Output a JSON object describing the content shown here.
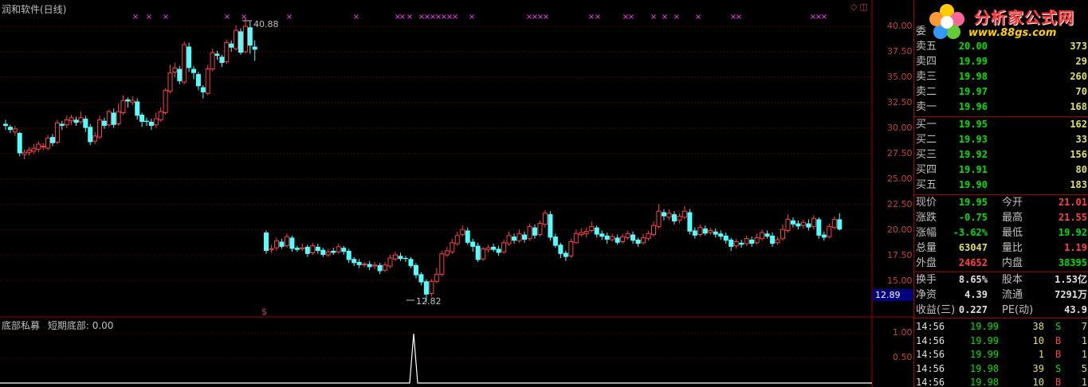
{
  "window": {
    "title": "润和软件(日线)"
  },
  "indicator": {
    "name": "底部私募",
    "line_label": "短期底部: 0.00"
  },
  "price_axis": [
    "40.00",
    "37.50",
    "35.00",
    "32.50",
    "30.00",
    "27.50",
    "25.00",
    "22.50",
    "20.00",
    "17.50",
    "15.00"
  ],
  "indicator_axis": [
    "1.00",
    "0.50"
  ],
  "annotations": {
    "high": "40.88",
    "low": "12.82",
    "current_price_marker": "12.89",
    "signal_mark": "$"
  },
  "logo": {
    "text": "分析家公式网",
    "url": "www.88gs.com"
  },
  "colors": {
    "up": "#ff4040",
    "down": "#54ffff",
    "grid": "#800000",
    "axis_text": "#c84040",
    "signal": "#ff40ff"
  },
  "quote": {
    "header_label": "委",
    "asks": [
      {
        "label": "卖五",
        "price": "20.00",
        "vol": "373"
      },
      {
        "label": "卖四",
        "price": "19.99",
        "vol": "29"
      },
      {
        "label": "卖三",
        "price": "19.98",
        "vol": "260"
      },
      {
        "label": "卖二",
        "price": "19.97",
        "vol": "70"
      },
      {
        "label": "卖一",
        "price": "19.96",
        "vol": "168"
      }
    ],
    "bids": [
      {
        "label": "买一",
        "price": "19.95",
        "vol": "162"
      },
      {
        "label": "买二",
        "price": "19.93",
        "vol": "33"
      },
      {
        "label": "买三",
        "price": "19.92",
        "vol": "156"
      },
      {
        "label": "买四",
        "price": "19.91",
        "vol": "80"
      },
      {
        "label": "买五",
        "price": "19.90",
        "vol": "183"
      }
    ],
    "stats": [
      {
        "l1": "现价",
        "v1": "19.95",
        "l2": "今开",
        "v2": "21.01",
        "c1": "green",
        "c2": "red"
      },
      {
        "l1": "涨跌",
        "v1": "-0.75",
        "l2": "最高",
        "v2": "21.55",
        "c1": "green",
        "c2": "red"
      },
      {
        "l1": "涨幅",
        "v1": "-3.62%",
        "l2": "最低",
        "v2": "19.92",
        "c1": "green",
        "c2": "green"
      },
      {
        "l1": "总量",
        "v1": "63047",
        "l2": "量比",
        "v2": "1.19",
        "c1": "yellow",
        "c2": "red"
      },
      {
        "l1": "外盘",
        "v1": "24652",
        "l2": "内盘",
        "v2": "38395",
        "c1": "red",
        "c2": "green"
      }
    ],
    "stats2": [
      {
        "l1": "换手",
        "v1": "8.65%",
        "l2": "股本",
        "v2": "1.53亿"
      },
      {
        "l1": "净资",
        "v1": "4.39",
        "l2": "流通",
        "v2": "7291万"
      },
      {
        "l1": "收益(三)",
        "v1": "0.227",
        "l2": "PE(动)",
        "v2": "43.9"
      }
    ],
    "ticks": [
      {
        "time": "14:56",
        "price": "19.99",
        "vol": "38",
        "side": "S",
        "n": "7"
      },
      {
        "time": "14:56",
        "price": "19.99",
        "vol": "10",
        "side": "B",
        "n": "1"
      },
      {
        "time": "14:56",
        "price": "19.99",
        "vol": "1",
        "side": "B",
        "n": "1"
      },
      {
        "time": "14:56",
        "price": "19.98",
        "vol": "39",
        "side": "S",
        "n": "5"
      },
      {
        "time": "14:56",
        "price": "19.98",
        "vol": "10",
        "side": "B",
        "n": "1"
      }
    ]
  },
  "chart_data": {
    "type": "candlestick",
    "ylim": [
      12,
      42
    ],
    "candles": [
      [
        30.4,
        30.2,
        30.8,
        29.8
      ],
      [
        30.1,
        29.8,
        30.3,
        29.5
      ],
      [
        29.6,
        29.9,
        30.2,
        29.2
      ],
      [
        29.5,
        27.5,
        29.6,
        27.2
      ],
      [
        27.4,
        27.6,
        27.9,
        26.9
      ],
      [
        27.6,
        27.8,
        28.1,
        27.3
      ],
      [
        27.7,
        28.0,
        28.4,
        27.4
      ],
      [
        27.9,
        28.4,
        28.7,
        27.6
      ],
      [
        28.2,
        28.2,
        28.5,
        27.8
      ],
      [
        28.0,
        29.0,
        29.3,
        27.8
      ],
      [
        29.1,
        28.5,
        29.4,
        28.2
      ],
      [
        28.6,
        30.5,
        30.8,
        28.4
      ],
      [
        30.4,
        30.2,
        30.7,
        29.8
      ],
      [
        30.3,
        30.8,
        31.2,
        30.0
      ],
      [
        30.7,
        31.0,
        31.3,
        30.3
      ],
      [
        30.8,
        30.5,
        31.1,
        30.2
      ],
      [
        30.6,
        31.0,
        31.6,
        30.4
      ],
      [
        30.9,
        30.0,
        31.2,
        29.6
      ],
      [
        30.1,
        28.6,
        30.4,
        28.3
      ],
      [
        28.7,
        29.2,
        29.6,
        28.4
      ],
      [
        29.1,
        30.8,
        31.2,
        28.9
      ],
      [
        30.7,
        30.2,
        31.0,
        29.9
      ],
      [
        30.3,
        31.6,
        31.8,
        30.1
      ],
      [
        31.5,
        30.3,
        31.9,
        30.0
      ],
      [
        30.4,
        31.6,
        32.4,
        30.2
      ],
      [
        31.5,
        32.7,
        33.2,
        31.3
      ],
      [
        32.8,
        32.6,
        33.0,
        32.0
      ],
      [
        32.5,
        32.7,
        33.1,
        32.2
      ],
      [
        32.6,
        31.2,
        32.9,
        30.8
      ],
      [
        31.3,
        30.6,
        31.5,
        30.1
      ],
      [
        30.7,
        30.6,
        31.0,
        30.2
      ],
      [
        30.6,
        30.2,
        30.9,
        29.8
      ],
      [
        30.3,
        30.9,
        31.5,
        30.0
      ],
      [
        30.8,
        31.6,
        32.0,
        30.6
      ],
      [
        31.5,
        33.7,
        33.9,
        31.3
      ],
      [
        33.6,
        35.4,
        36.2,
        33.4
      ],
      [
        35.5,
        35.9,
        36.4,
        35.0
      ],
      [
        35.8,
        34.6,
        36.1,
        34.3
      ],
      [
        34.5,
        38.2,
        38.5,
        34.3
      ],
      [
        38.0,
        35.9,
        38.4,
        35.5
      ],
      [
        35.8,
        35.4,
        36.1,
        34.8
      ],
      [
        35.3,
        34.1,
        35.5,
        33.7
      ],
      [
        34.0,
        33.5,
        34.2,
        32.9
      ],
      [
        33.4,
        35.8,
        36.2,
        33.2
      ],
      [
        35.8,
        37.4,
        37.8,
        35.6
      ],
      [
        37.3,
        37.1,
        37.6,
        36.7
      ],
      [
        37.0,
        36.4,
        37.2,
        36.0
      ],
      [
        36.5,
        38.4,
        38.7,
        36.3
      ],
      [
        38.3,
        37.9,
        38.6,
        37.5
      ],
      [
        37.8,
        39.6,
        40.1,
        37.6
      ],
      [
        39.5,
        37.4,
        39.8,
        37.2
      ],
      [
        37.5,
        40.0,
        40.9,
        37.3
      ],
      [
        39.9,
        38.1,
        40.5,
        37.3
      ],
      [
        38.0,
        37.7,
        38.6,
        36.6
      ]
    ],
    "candles2": [
      [
        19.7,
        17.9,
        19.9,
        17.6
      ],
      [
        18.0,
        18.1,
        18.5,
        17.7
      ],
      [
        18.2,
        18.9,
        19.2,
        17.9
      ],
      [
        18.8,
        18.3,
        19.1,
        18.1
      ],
      [
        18.4,
        19.3,
        19.6,
        18.2
      ],
      [
        19.2,
        18.1,
        19.4,
        17.8
      ],
      [
        18.2,
        18.0,
        18.4,
        17.8
      ],
      [
        18.1,
        18.2,
        18.6,
        17.9
      ],
      [
        18.3,
        17.6,
        18.5,
        17.3
      ],
      [
        17.7,
        18.4,
        18.7,
        17.5
      ],
      [
        18.3,
        17.9,
        18.6,
        17.6
      ],
      [
        18.0,
        17.5,
        18.2,
        17.3
      ],
      [
        17.5,
        17.8,
        18.1,
        17.3
      ],
      [
        17.9,
        17.7,
        18.2,
        17.5
      ],
      [
        17.8,
        18.3,
        18.6,
        17.6
      ],
      [
        18.2,
        17.8,
        18.4,
        17.5
      ],
      [
        17.9,
        17.0,
        18.1,
        16.7
      ],
      [
        17.1,
        16.7,
        17.3,
        16.4
      ],
      [
        16.8,
        16.5,
        17.1,
        16.2
      ],
      [
        16.6,
        16.6,
        16.8,
        16.3
      ],
      [
        16.6,
        16.3,
        16.9,
        16.0
      ],
      [
        16.4,
        16.5,
        16.8,
        16.1
      ],
      [
        16.5,
        15.9,
        16.7,
        15.6
      ],
      [
        16.0,
        16.5,
        16.8,
        15.8
      ],
      [
        16.4,
        17.2,
        17.5,
        16.2
      ],
      [
        17.1,
        17.5,
        17.8,
        16.9
      ],
      [
        17.4,
        17.1,
        17.7,
        16.9
      ],
      [
        17.2,
        17.1,
        17.4,
        16.8
      ],
      [
        17.1,
        16.4,
        17.3,
        16.2
      ],
      [
        16.5,
        15.5,
        16.7,
        15.2
      ],
      [
        15.6,
        14.8,
        15.8,
        14.5
      ],
      [
        14.9,
        13.6,
        15.1,
        12.8
      ],
      [
        13.7,
        14.9,
        15.1,
        13.4
      ],
      [
        14.9,
        15.6,
        16.2,
        14.7
      ],
      [
        15.6,
        17.6,
        17.9,
        15.4
      ],
      [
        17.5,
        17.9,
        18.3,
        17.3
      ],
      [
        17.8,
        18.7,
        19.1,
        17.6
      ],
      [
        18.6,
        19.4,
        19.8,
        18.4
      ],
      [
        19.5,
        20.0,
        20.4,
        19.3
      ],
      [
        19.9,
        18.7,
        20.2,
        18.5
      ],
      [
        18.8,
        18.3,
        19.1,
        17.8
      ],
      [
        18.4,
        17.0,
        18.7,
        16.8
      ],
      [
        17.1,
        18.1,
        18.3,
        16.9
      ],
      [
        18.0,
        18.2,
        18.5,
        17.7
      ],
      [
        18.3,
        18.0,
        18.6,
        17.8
      ],
      [
        18.1,
        17.7,
        18.4,
        17.4
      ],
      [
        17.8,
        18.7,
        19.0,
        17.6
      ],
      [
        18.6,
        19.4,
        19.8,
        18.4
      ],
      [
        19.3,
        18.9,
        19.6,
        18.6
      ],
      [
        18.9,
        19.6,
        20.0,
        18.7
      ],
      [
        19.5,
        19.0,
        19.8,
        18.7
      ],
      [
        19.1,
        20.3,
        20.6,
        18.9
      ],
      [
        20.2,
        19.4,
        20.5,
        19.1
      ],
      [
        19.5,
        20.6,
        20.9,
        19.3
      ],
      [
        20.5,
        21.6,
        21.9,
        20.2
      ],
      [
        21.5,
        19.2,
        21.8,
        18.9
      ],
      [
        19.3,
        18.4,
        19.6,
        18.2
      ],
      [
        18.5,
        17.6,
        18.7,
        17.2
      ],
      [
        17.7,
        17.3,
        17.9,
        16.9
      ],
      [
        17.4,
        18.8,
        19.1,
        17.2
      ],
      [
        18.7,
        19.6,
        20.0,
        18.6
      ],
      [
        19.5,
        19.7,
        20.1,
        19.3
      ],
      [
        19.6,
        19.8,
        20.2,
        19.2
      ],
      [
        19.9,
        20.3,
        20.8,
        19.7
      ],
      [
        20.2,
        19.5,
        20.4,
        19.2
      ],
      [
        19.6,
        19.3,
        19.9,
        19.0
      ],
      [
        19.4,
        19.0,
        19.7,
        18.6
      ],
      [
        19.0,
        19.3,
        19.6,
        18.8
      ],
      [
        19.2,
        18.7,
        19.5,
        18.5
      ],
      [
        18.8,
        19.3,
        19.6,
        18.6
      ],
      [
        19.2,
        19.6,
        19.9,
        19.0
      ],
      [
        19.5,
        18.9,
        19.8,
        18.6
      ],
      [
        19.0,
        18.6,
        19.2,
        18.3
      ],
      [
        18.7,
        19.2,
        19.6,
        18.5
      ],
      [
        19.1,
        19.6,
        19.9,
        18.9
      ],
      [
        19.5,
        20.4,
        20.8,
        19.3
      ],
      [
        20.3,
        21.8,
        22.5,
        20.1
      ],
      [
        21.7,
        21.3,
        22.0,
        20.9
      ],
      [
        21.2,
        21.6,
        22.0,
        20.9
      ],
      [
        21.5,
        20.8,
        21.8,
        20.5
      ],
      [
        20.9,
        21.3,
        21.6,
        20.6
      ],
      [
        21.2,
        21.8,
        22.3,
        21.0
      ],
      [
        21.7,
        19.8,
        22.0,
        19.5
      ],
      [
        19.9,
        19.4,
        20.2,
        19.1
      ],
      [
        19.5,
        20.2,
        20.5,
        19.3
      ],
      [
        20.1,
        19.6,
        20.4,
        19.4
      ],
      [
        19.7,
        19.9,
        20.2,
        19.5
      ],
      [
        19.8,
        19.5,
        20.1,
        19.2
      ],
      [
        19.6,
        19.3,
        19.9,
        19.0
      ],
      [
        19.4,
        18.9,
        19.7,
        18.6
      ],
      [
        19.0,
        18.3,
        19.2,
        17.9
      ],
      [
        18.4,
        18.8,
        19.1,
        18.1
      ],
      [
        18.7,
        18.5,
        19.0,
        18.2
      ],
      [
        18.6,
        19.1,
        19.4,
        18.4
      ],
      [
        19.0,
        18.6,
        19.3,
        18.3
      ],
      [
        18.7,
        19.2,
        19.6,
        18.5
      ],
      [
        19.1,
        19.7,
        20.0,
        18.9
      ],
      [
        19.6,
        19.3,
        19.9,
        19.1
      ],
      [
        19.4,
        18.6,
        19.7,
        18.3
      ],
      [
        18.7,
        19.0,
        19.3,
        18.5
      ],
      [
        19.1,
        20.0,
        20.5,
        18.9
      ],
      [
        19.9,
        21.0,
        21.5,
        19.7
      ],
      [
        20.9,
        20.5,
        21.2,
        20.2
      ],
      [
        20.6,
        20.3,
        20.9,
        20.0
      ],
      [
        20.4,
        20.7,
        21.0,
        20.1
      ],
      [
        20.6,
        20.2,
        21.0,
        19.9
      ],
      [
        20.3,
        21.1,
        21.4,
        20.0
      ],
      [
        21.0,
        19.4,
        21.2,
        19.1
      ],
      [
        19.5,
        19.2,
        19.8,
        18.9
      ],
      [
        19.3,
        20.3,
        20.6,
        19.1
      ],
      [
        20.2,
        21.0,
        21.3,
        20.0
      ],
      [
        21.0,
        20.0,
        21.6,
        19.9
      ]
    ],
    "signal_marks_x": [
      170,
      187,
      208,
      285,
      306,
      363,
      447,
      499,
      505,
      514,
      529,
      536,
      543,
      550,
      557,
      564,
      571,
      592,
      664,
      671,
      678,
      685,
      742,
      750,
      785,
      792,
      820,
      834,
      849,
      876,
      920,
      927,
      1020,
      1027,
      1034
    ],
    "indicator": {
      "spike_index": 29,
      "values": "0 except spike=1.00"
    }
  }
}
